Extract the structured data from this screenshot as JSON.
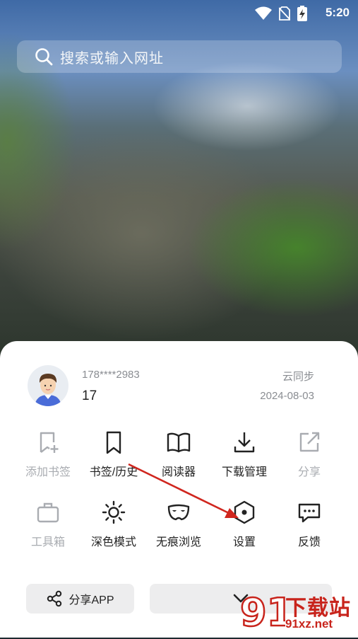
{
  "status_bar": {
    "time": "5:20"
  },
  "search": {
    "placeholder": "搜索或输入网址"
  },
  "account": {
    "phone": "178****2983",
    "level": "17",
    "sync_label": "云同步",
    "sync_date": "2024-08-03"
  },
  "menu_row1": [
    {
      "label": "添加书签",
      "icon": "bookmark-add-icon",
      "enabled": false
    },
    {
      "label": "书签/历史",
      "icon": "bookmark-icon",
      "enabled": true
    },
    {
      "label": "阅读器",
      "icon": "book-open-icon",
      "enabled": true
    },
    {
      "label": "下载管理",
      "icon": "download-icon",
      "enabled": true
    },
    {
      "label": "分享",
      "icon": "share-external-icon",
      "enabled": false
    }
  ],
  "menu_row2": [
    {
      "label": "工具箱",
      "icon": "toolbox-icon",
      "enabled": false
    },
    {
      "label": "深色模式",
      "icon": "sun-icon",
      "enabled": true
    },
    {
      "label": "无痕浏览",
      "icon": "mask-icon",
      "enabled": true
    },
    {
      "label": "设置",
      "icon": "settings-hexagon-icon",
      "enabled": true
    },
    {
      "label": "反馈",
      "icon": "feedback-chat-icon",
      "enabled": true
    }
  ],
  "bottom": {
    "share_app_label": "分享APP",
    "collapse_icon": "chevron-down-icon"
  },
  "watermark": {
    "text_main": "下载站",
    "text_url": "91xz.net",
    "logo_digits": "91"
  },
  "colors": {
    "accent_red": "#d0261e",
    "disabled_gray": "#a9acb1",
    "button_bg": "#ededee"
  }
}
